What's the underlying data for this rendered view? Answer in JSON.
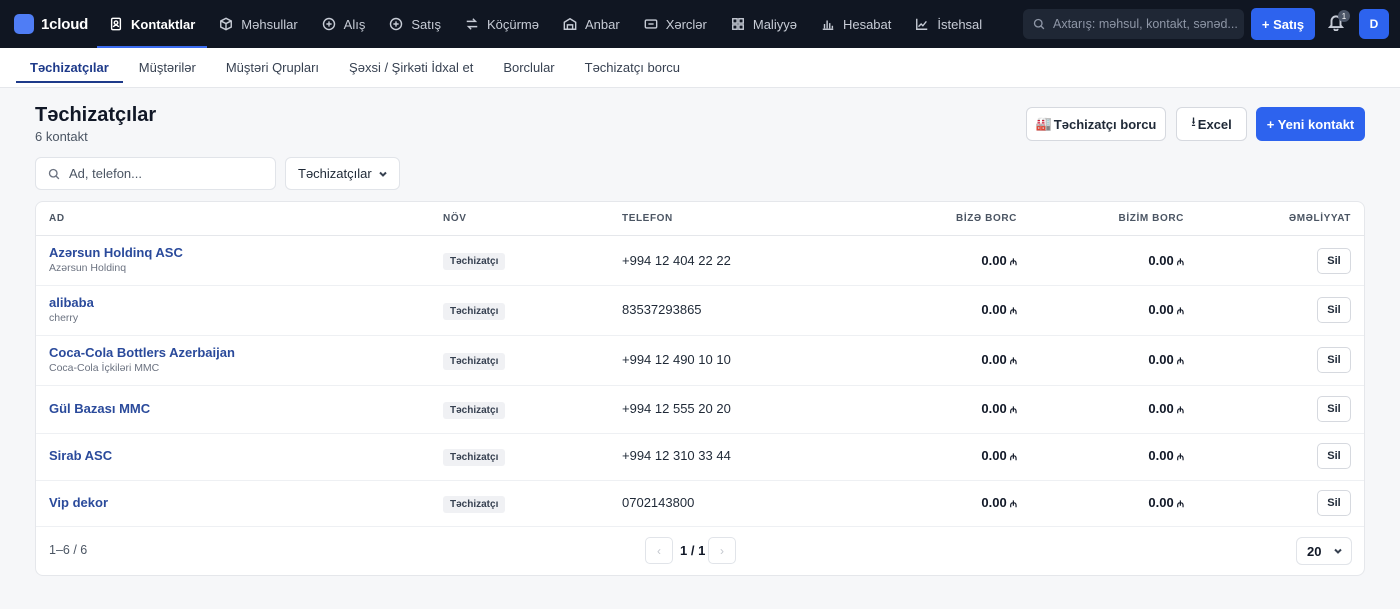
{
  "brand": {
    "name": "1cloud",
    "accent": "#2d63ee"
  },
  "nav": {
    "items": [
      {
        "label": "Kontaktlar",
        "icon": "contacts-icon",
        "active": true
      },
      {
        "label": "Məhsullar",
        "icon": "box-icon"
      },
      {
        "label": "Alış",
        "icon": "plus-circle-icon"
      },
      {
        "label": "Satış",
        "icon": "plus-circle-icon"
      },
      {
        "label": "Köçürmə",
        "icon": "transfer-icon"
      },
      {
        "label": "Anbar",
        "icon": "warehouse-icon"
      },
      {
        "label": "Xərclər",
        "icon": "wallet-icon"
      },
      {
        "label": "Maliyyə",
        "icon": "grid-icon"
      },
      {
        "label": "Hesabat",
        "icon": "bar-chart-icon"
      },
      {
        "label": "İstehsal",
        "icon": "line-chart-icon"
      }
    ],
    "search_placeholder": "Axtarış: məhsul, kontakt, sənəd...",
    "sale_button": "+ Satış",
    "notifications_count": "1",
    "avatar_initial": "D"
  },
  "subnav": {
    "tabs": [
      {
        "label": "Təchizatçılar",
        "active": true
      },
      {
        "label": "Müştərilər"
      },
      {
        "label": "Müştəri Qrupları"
      },
      {
        "label": "Şəxsi / Şirkəti İdxal et"
      },
      {
        "label": "Borclular"
      },
      {
        "label": "Təchizatçı borcu"
      }
    ]
  },
  "header": {
    "title": "Təchizatçılar",
    "subtitle": "6 kontakt",
    "supplier_debt_button": "Təchizatçı borcu",
    "excel_button": "Excel",
    "new_contact_button": "+ Yeni kontakt"
  },
  "filters": {
    "search_placeholder": "Ad, telefon...",
    "type_select": "Təchizatçılar"
  },
  "table": {
    "columns": {
      "name": "AD",
      "type": "NÖV",
      "phone": "TELEFON",
      "debt_to_us": "BİZƏ BORC",
      "our_debt": "BİZİM BORC",
      "actions": "ƏMƏLİYYAT"
    },
    "currency_symbol": "₼",
    "delete_label": "Sil",
    "rows": [
      {
        "name": "Azərsun Holdinq ASC",
        "subname": "Azərsun Holdinq",
        "type": "Təchizatçı",
        "phone": "+994 12 404 22 22",
        "debt_to_us": "0.00",
        "our_debt": "0.00"
      },
      {
        "name": "alibaba",
        "subname": "cherry",
        "type": "Təchizatçı",
        "phone": "83537293865",
        "debt_to_us": "0.00",
        "our_debt": "0.00"
      },
      {
        "name": "Coca-Cola Bottlers Azerbaijan",
        "subname": "Coca-Cola İçkiləri MMC",
        "type": "Təchizatçı",
        "phone": "+994 12 490 10 10",
        "debt_to_us": "0.00",
        "our_debt": "0.00"
      },
      {
        "name": "Gül Bazası MMC",
        "subname": "",
        "type": "Təchizatçı",
        "phone": "+994 12 555 20 20",
        "debt_to_us": "0.00",
        "our_debt": "0.00"
      },
      {
        "name": "Sirab ASC",
        "subname": "",
        "type": "Təchizatçı",
        "phone": "+994 12 310 33 44",
        "debt_to_us": "0.00",
        "our_debt": "0.00"
      },
      {
        "name": "Vip dekor",
        "subname": "",
        "type": "Təchizatçı",
        "phone": "0702143800",
        "debt_to_us": "0.00",
        "our_debt": "0.00"
      }
    ]
  },
  "pagination": {
    "range": "1–6 / 6",
    "page_label": "1 / 1",
    "prev": "‹",
    "next": "›",
    "per_page": "20"
  }
}
